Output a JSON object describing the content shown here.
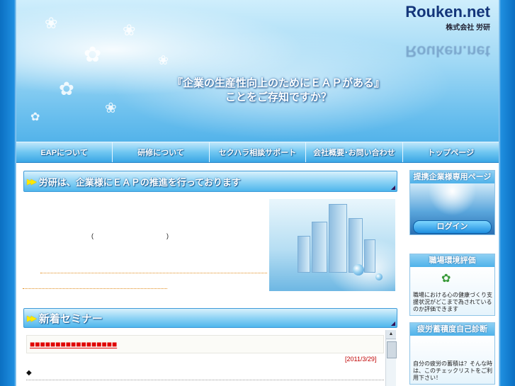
{
  "logo": {
    "name": "Rouken.net",
    "company": "株式会社 労研"
  },
  "headline": {
    "line1": "『企業の生産性向上のためにＥＡＰがある』",
    "line2": "ことをご存知ですか？"
  },
  "nav": [
    {
      "label": "EAPについて"
    },
    {
      "label": "研修について"
    },
    {
      "label": "セクハラ相談サポート"
    },
    {
      "label": "会社概要･お問い合わせ"
    },
    {
      "label": "トップページ"
    }
  ],
  "section1": {
    "arrows": "▶▶",
    "title": "労研は、企業様にＥＡＰの推進を行っております",
    "paren_open": "(",
    "paren_close": ")"
  },
  "section2": {
    "arrows": "▶▶",
    "title": "新着セミナー",
    "news_link": "■■■■■■■■■■■■■■■■■",
    "news_date": "[2011/3/29]",
    "bullet": "◆"
  },
  "sidebar": {
    "partner": {
      "title": "提携企業様専用ページ",
      "login": "ログイン"
    },
    "workplace": {
      "title": "職場環境評価",
      "text": "職場における心の健康づくり支援状況がどこまで為されているのか評価できます"
    },
    "fatigue": {
      "title": "疲労蓄積度自己診断",
      "text": "自分の疲労の蓄積は？そんな時は、このチェックリストをご利用下さい！"
    }
  }
}
